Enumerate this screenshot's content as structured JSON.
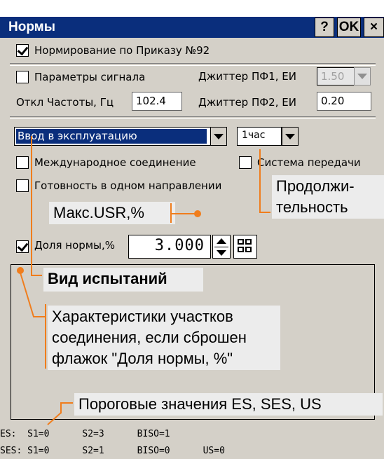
{
  "window": {
    "title": "Нормы",
    "help_label": "?",
    "ok_label": "OK",
    "close_label": "×"
  },
  "top_checkbox": {
    "label": "Нормирование по Приказу №92",
    "checked": true
  },
  "signal": {
    "params_label": "Параметры сигнала",
    "params_checked": false,
    "jitter1_label": "Джиттер ПФ1, ЕИ",
    "jitter1_value": "1.50",
    "freq_label": "Откл Частоты, Гц",
    "freq_value": "102.4",
    "jitter2_label": "Джиттер ПФ2, ЕИ",
    "jitter2_value": "0.20"
  },
  "test": {
    "type_value": "Ввод в эксплуатацию",
    "duration_value": "1час",
    "international_label": "Международное соединение",
    "transmission_label": "Система передачи",
    "one_direction_label": "Готовность в одном направлении",
    "share_label": "Доля нормы,%",
    "share_checked": true,
    "share_value": "3.000"
  },
  "callouts": {
    "max_usr": "Макс.USR,%",
    "duration_line1": "Продолжи-",
    "duration_line2": "тельность",
    "test_type": "Вид испытаний",
    "sections_line1": "Характеристики участков",
    "sections_line2": "соединения, если сброшен",
    "sections_line3": "флажок \"Доля нормы, %\"",
    "thresholds": "Пороговые значения ES, SES, US"
  },
  "thresholds": {
    "es_line": "ES:  S1=0      S2=3      BISO=1",
    "ses_line": "SES: S1=0      S2=1      BISO=0      US=0"
  },
  "colors": {
    "titlebar": "#0a2e7c",
    "accent": "#f07d1c",
    "panel": "#d4d0c8",
    "selection": "#0a2e7c"
  }
}
